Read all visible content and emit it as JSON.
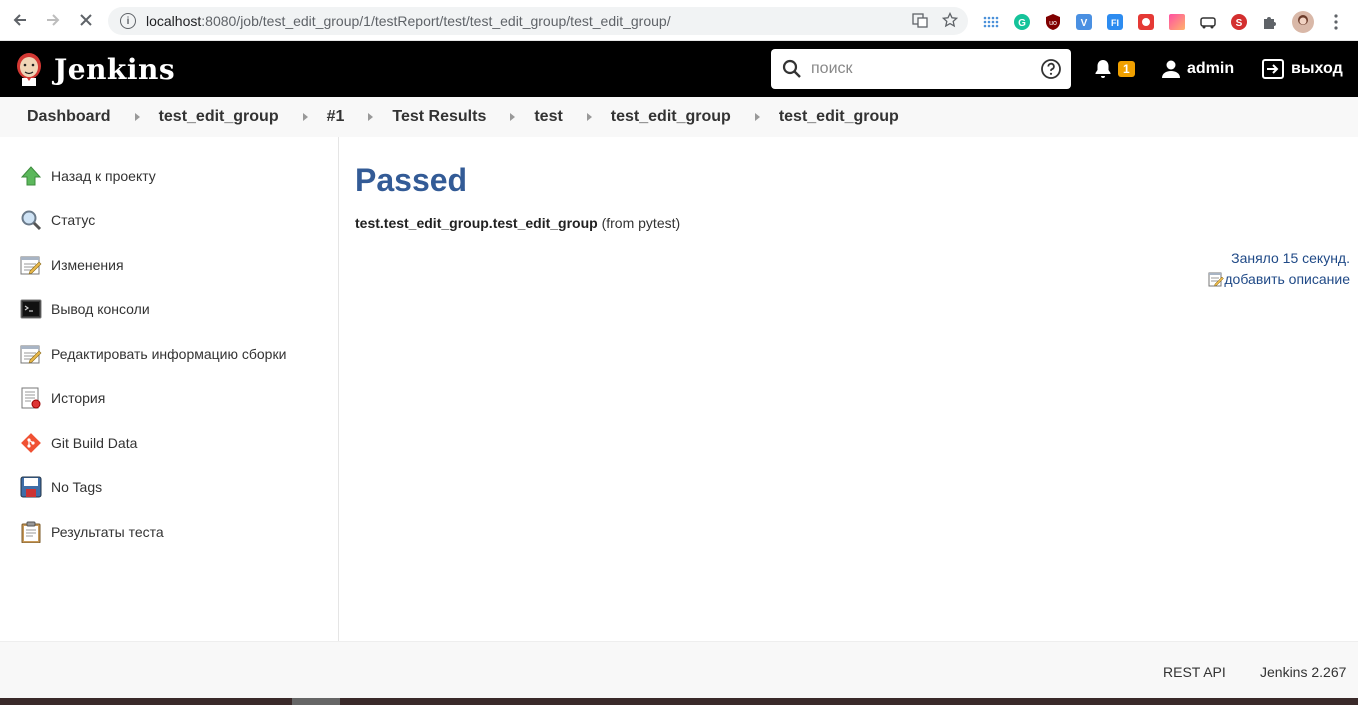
{
  "browser": {
    "url_host": "localhost",
    "url_path": ":8080/job/test_edit_group/1/testReport/test/test_edit_group/test_edit_group/"
  },
  "header": {
    "logo_text": "Jenkins",
    "search_placeholder": "поиск",
    "notifications_count": "1",
    "user": "admin",
    "logout": "выход"
  },
  "breadcrumbs": [
    "Dashboard",
    "test_edit_group",
    "#1",
    "Test Results",
    "test",
    "test_edit_group",
    "test_edit_group"
  ],
  "sidebar": {
    "items": [
      {
        "label": "Назад к проекту",
        "icon": "up-arrow-icon"
      },
      {
        "label": "Статус",
        "icon": "magnifier-icon"
      },
      {
        "label": "Изменения",
        "icon": "notepad-icon"
      },
      {
        "label": "Вывод консоли",
        "icon": "terminal-icon"
      },
      {
        "label": "Редактировать информацию сборки",
        "icon": "notepad-edit-icon"
      },
      {
        "label": "История",
        "icon": "history-icon"
      },
      {
        "label": "Git Build Data",
        "icon": "git-icon"
      },
      {
        "label": "No Tags",
        "icon": "floppy-icon"
      },
      {
        "label": "Результаты теста",
        "icon": "clipboard-icon"
      }
    ]
  },
  "main": {
    "status": "Passed",
    "test_name": "test.test_edit_group.test_edit_group",
    "test_source": "(from pytest)",
    "took": "Заняло 15 секунд.",
    "add_description": "добавить описание"
  },
  "footer": {
    "rest_api": "REST API",
    "version": "Jenkins 2.267"
  },
  "colors": {
    "title": "#335b96",
    "link": "#204a87",
    "header_bg": "#000000",
    "badge": "#f0a000"
  }
}
